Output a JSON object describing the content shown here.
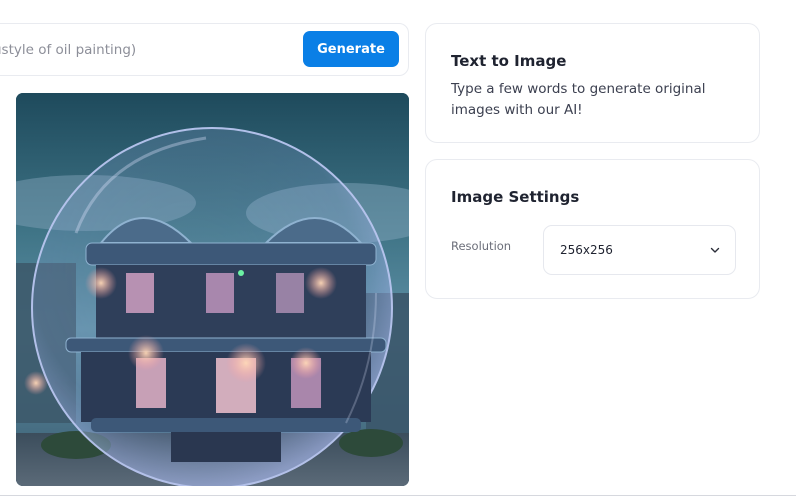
{
  "prompt": {
    "placeholder": "ustyle of oil painting)",
    "generate_label": "Generate"
  },
  "generated_image": {
    "description_icon": "bubble-house-image"
  },
  "info_card": {
    "title": "Text to Image",
    "description": "Type a few words to generate original images with our AI!"
  },
  "settings_card": {
    "title": "Image Settings",
    "resolution_label": "Resolution",
    "resolution_value": "256x256",
    "chevron_icon": "chevron-down-icon"
  },
  "colors": {
    "accent": "#0a7fe6",
    "card_border": "#e9ebf0",
    "text_primary": "#1f2330",
    "text_secondary": "#3c4050"
  }
}
